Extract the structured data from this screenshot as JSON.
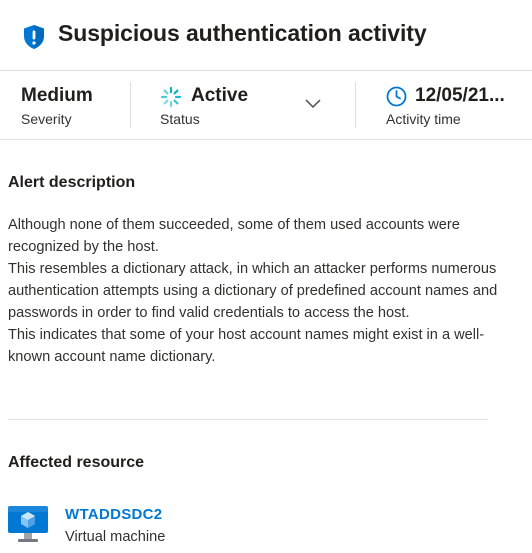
{
  "header": {
    "title": "Suspicious authentication activity",
    "icon": "shield-alert-icon",
    "icon_color": "#0078d4"
  },
  "summary": {
    "severity": {
      "value": "Medium",
      "label": "Severity"
    },
    "status": {
      "value": "Active",
      "label": "Status",
      "icon": "spinner-icon",
      "icon_color": "#00b7c3"
    },
    "activity_time": {
      "value": "12/05/21...",
      "label": "Activity time",
      "icon": "clock-icon",
      "icon_color": "#0078d4"
    }
  },
  "alert_description": {
    "heading": "Alert description",
    "paragraphs": [
      "Although none of them succeeded, some of them used accounts were recognized by the host.",
      "This resembles a dictionary attack, in which an attacker performs numerous authentication attempts using a dictionary of predefined account names and passwords in order to find valid credentials to access the host.",
      "This indicates that some of your host account names might exist in a well-known account name dictionary."
    ]
  },
  "affected_resource": {
    "heading": "Affected resource",
    "name": "WTADDSDC2",
    "type": "Virtual machine",
    "icon": "virtual-machine-icon",
    "link_color": "#0078d4"
  }
}
